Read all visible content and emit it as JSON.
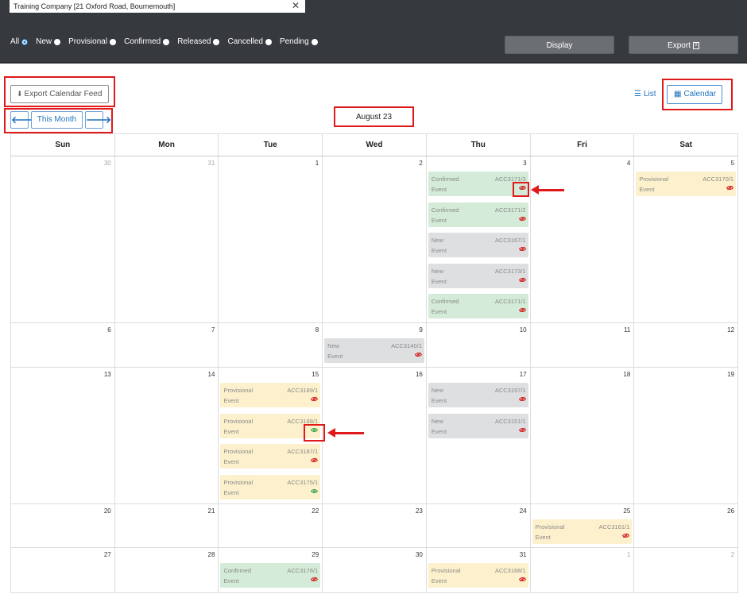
{
  "location": {
    "value": "Training Company [21 Oxford Road, Bournemouth]",
    "clear_icon": "close-icon"
  },
  "filters": [
    {
      "label": "All",
      "selected": true
    },
    {
      "label": "New",
      "selected": false
    },
    {
      "label": "Provisional",
      "selected": false
    },
    {
      "label": "Confirmed",
      "selected": false
    },
    {
      "label": "Released",
      "selected": false
    },
    {
      "label": "Cancelled",
      "selected": false
    },
    {
      "label": "Pending",
      "selected": false
    }
  ],
  "actions": {
    "display": "Display",
    "export": "Export"
  },
  "toolbar": {
    "export_feed": "Export Calendar Feed",
    "this_month": "This Month",
    "month_title": "August 23",
    "list": "List",
    "calendar": "Calendar"
  },
  "weekdays": [
    "Sun",
    "Mon",
    "Tue",
    "Wed",
    "Thu",
    "Fri",
    "Sat"
  ],
  "weeks": [
    {
      "days": [
        {
          "n": "30",
          "other": true,
          "events": []
        },
        {
          "n": "31",
          "other": true,
          "events": []
        },
        {
          "n": "1",
          "events": []
        },
        {
          "n": "2",
          "events": []
        },
        {
          "n": "3",
          "events": [
            {
              "status": "Confirmed",
              "code": "ACC3171/3",
              "type": "Event",
              "visible": false
            },
            {
              "status": "Confirmed",
              "code": "ACC3171/2",
              "type": "Event",
              "visible": false
            },
            {
              "status": "New",
              "code": "ACC3167/1",
              "type": "Event",
              "visible": false
            },
            {
              "status": "New",
              "code": "ACC3173/1",
              "type": "Event",
              "visible": false
            },
            {
              "status": "Confirmed",
              "code": "ACC3171/1",
              "type": "Event",
              "visible": false
            }
          ]
        },
        {
          "n": "4",
          "events": []
        },
        {
          "n": "5",
          "events": [
            {
              "status": "Provisional",
              "code": "ACC3170/1",
              "type": "Event",
              "visible": false
            }
          ]
        }
      ]
    },
    {
      "days": [
        {
          "n": "6",
          "events": []
        },
        {
          "n": "7",
          "events": []
        },
        {
          "n": "8",
          "events": []
        },
        {
          "n": "9",
          "events": [
            {
              "status": "New",
              "code": "ACC3140/1",
              "type": "Event",
              "visible": false
            }
          ]
        },
        {
          "n": "10",
          "events": []
        },
        {
          "n": "11",
          "events": []
        },
        {
          "n": "12",
          "events": []
        }
      ]
    },
    {
      "days": [
        {
          "n": "13",
          "events": []
        },
        {
          "n": "14",
          "events": []
        },
        {
          "n": "15",
          "events": [
            {
              "status": "Provisional",
              "code": "ACC3189/1",
              "type": "Event",
              "visible": false
            },
            {
              "status": "Provisional",
              "code": "ACC3188/1",
              "type": "Event",
              "visible": true
            },
            {
              "status": "Provisional",
              "code": "ACC3187/1",
              "type": "Event",
              "visible": false
            },
            {
              "status": "Provisional",
              "code": "ACC3175/1",
              "type": "Event",
              "visible": true
            }
          ]
        },
        {
          "n": "16",
          "events": []
        },
        {
          "n": "17",
          "events": [
            {
              "status": "New",
              "code": "ACC3197/1",
              "type": "Event",
              "visible": false
            },
            {
              "status": "New",
              "code": "ACC3151/1",
              "type": "Event",
              "visible": false
            }
          ]
        },
        {
          "n": "18",
          "events": []
        },
        {
          "n": "19",
          "events": []
        }
      ]
    },
    {
      "days": [
        {
          "n": "20",
          "events": []
        },
        {
          "n": "21",
          "events": []
        },
        {
          "n": "22",
          "events": []
        },
        {
          "n": "23",
          "events": []
        },
        {
          "n": "24",
          "events": []
        },
        {
          "n": "25",
          "events": [
            {
              "status": "Provisional",
              "code": "ACC3161/1",
              "type": "Event",
              "visible": false
            }
          ]
        },
        {
          "n": "26",
          "events": []
        }
      ]
    },
    {
      "days": [
        {
          "n": "27",
          "events": []
        },
        {
          "n": "28",
          "events": []
        },
        {
          "n": "29",
          "events": [
            {
              "status": "Confirmed",
              "code": "ACC3176/1",
              "type": "Event",
              "visible": false
            }
          ]
        },
        {
          "n": "30",
          "events": []
        },
        {
          "n": "31",
          "events": [
            {
              "status": "Provisional",
              "code": "ACC3168/1",
              "type": "Event",
              "visible": false
            }
          ]
        },
        {
          "n": "1",
          "other": true,
          "events": []
        },
        {
          "n": "2",
          "other": true,
          "events": []
        }
      ]
    }
  ],
  "colors": {
    "confirmed": "#d3ebd8",
    "new": "#dedfe1",
    "provisional": "#fdf0cd",
    "annotation": "#e0191b",
    "accent": "#1e73be"
  }
}
